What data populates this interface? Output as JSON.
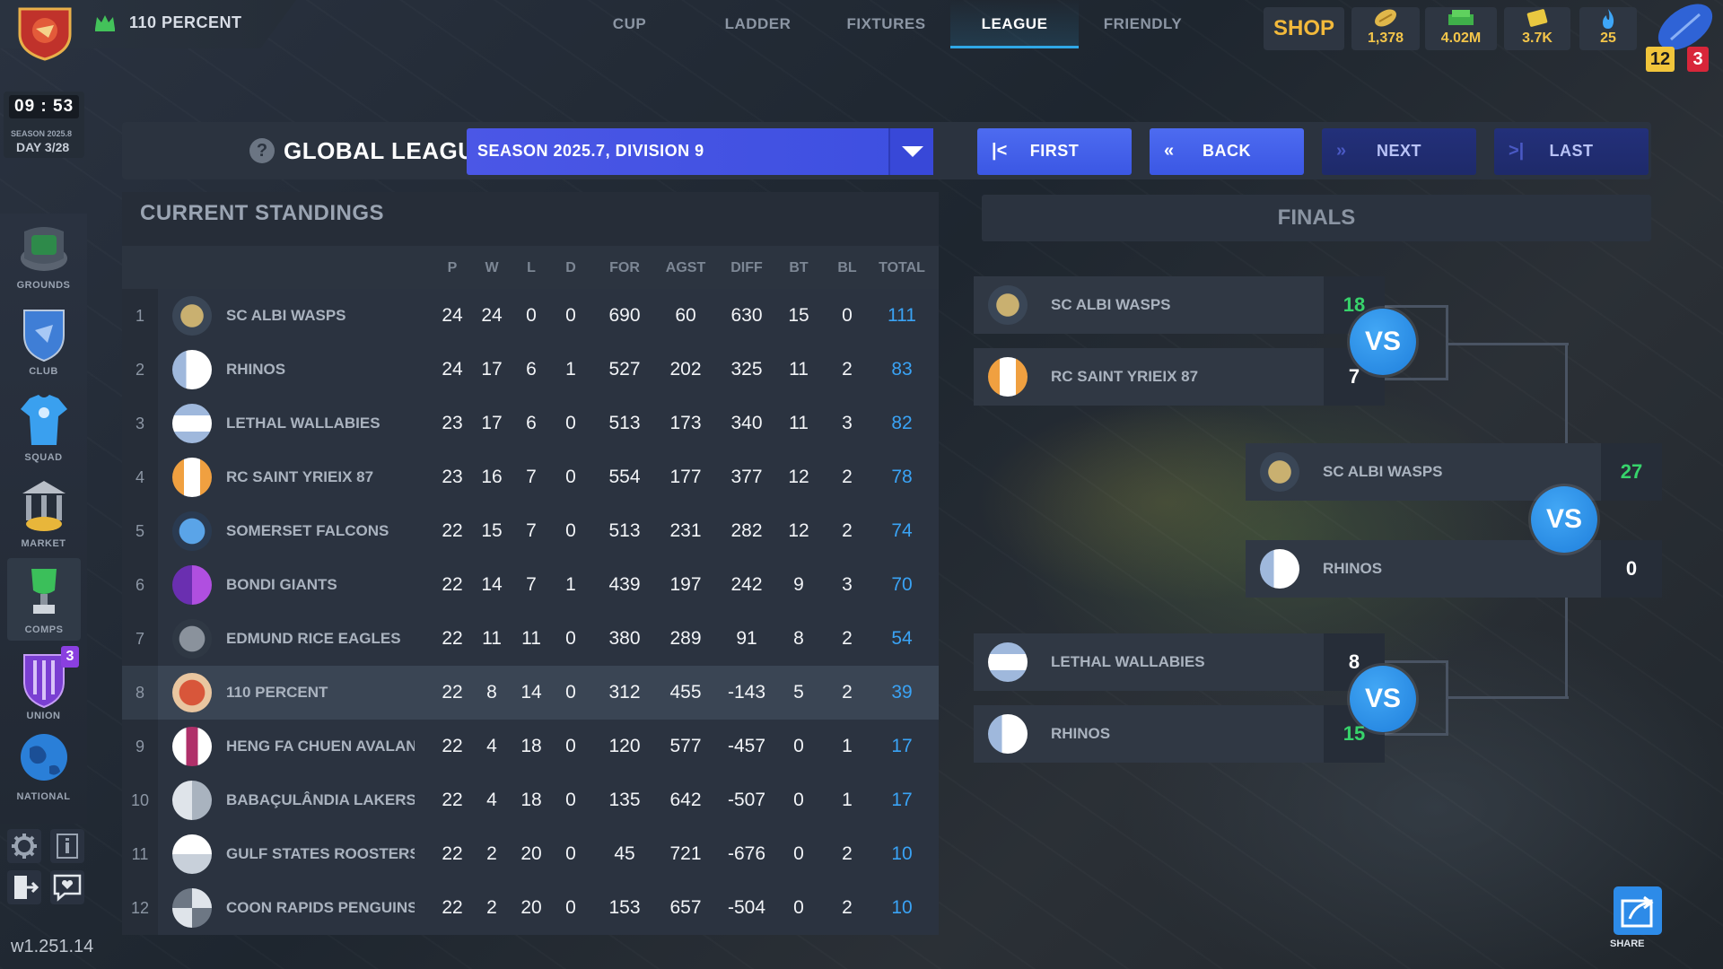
{
  "header": {
    "club_name": "110 PERCENT",
    "tabs": [
      "CUP",
      "LADDER",
      "FIXTURES",
      "LEAGUE",
      "FRIENDLY"
    ],
    "active_tab": "LEAGUE",
    "shop_label": "SHOP",
    "currencies": [
      {
        "icon": "rugby-ball-icon",
        "value": "1,378"
      },
      {
        "icon": "cash-icon",
        "value": "4.02M"
      },
      {
        "icon": "ticket-icon",
        "value": "3.7K"
      },
      {
        "icon": "flame-icon",
        "value": "25"
      }
    ],
    "level_badge": "12",
    "notification_badge": "3"
  },
  "timer": {
    "clock_h": "09",
    "clock_m": "53",
    "season": "SEASON 2025.8",
    "day": "DAY 3/28"
  },
  "sidebar": {
    "items": [
      {
        "label": "GROUNDS",
        "icon": "stadium-icon"
      },
      {
        "label": "CLUB",
        "icon": "club-crest-icon"
      },
      {
        "label": "SQUAD",
        "icon": "jersey-icon"
      },
      {
        "label": "MARKET",
        "icon": "bank-icon"
      },
      {
        "label": "COMPS",
        "icon": "trophy-icon"
      },
      {
        "label": "UNION",
        "icon": "union-shield-icon",
        "badge": "3"
      },
      {
        "label": "NATIONAL",
        "icon": "globe-icon"
      }
    ],
    "version": "w1.251.14"
  },
  "league": {
    "title": "GLOBAL LEAGUE",
    "season_select": "SEASON 2025.7, DIVISION 9",
    "nav": {
      "first": "FIRST",
      "back": "BACK",
      "next": "NEXT",
      "last": "LAST"
    }
  },
  "standings": {
    "title": "CURRENT STANDINGS",
    "columns": [
      "P",
      "W",
      "L",
      "D",
      "FOR",
      "AGST",
      "DIFF",
      "BT",
      "BL",
      "TOTAL"
    ],
    "rows": [
      {
        "rank": "1",
        "team": "SC ALBI WASPS",
        "p": "24",
        "w": "24",
        "l": "0",
        "d": "0",
        "for": "690",
        "agst": "60",
        "diff": "630",
        "bt": "15",
        "bl": "0",
        "total": "111"
      },
      {
        "rank": "2",
        "team": "RHINOS",
        "p": "24",
        "w": "17",
        "l": "6",
        "d": "1",
        "for": "527",
        "agst": "202",
        "diff": "325",
        "bt": "11",
        "bl": "2",
        "total": "83"
      },
      {
        "rank": "3",
        "team": "LETHAL WALLABIES",
        "p": "23",
        "w": "17",
        "l": "6",
        "d": "0",
        "for": "513",
        "agst": "173",
        "diff": "340",
        "bt": "11",
        "bl": "3",
        "total": "82"
      },
      {
        "rank": "4",
        "team": "RC SAINT YRIEIX 87",
        "p": "23",
        "w": "16",
        "l": "7",
        "d": "0",
        "for": "554",
        "agst": "177",
        "diff": "377",
        "bt": "12",
        "bl": "2",
        "total": "78"
      },
      {
        "rank": "5",
        "team": "SOMERSET FALCONS",
        "p": "22",
        "w": "15",
        "l": "7",
        "d": "0",
        "for": "513",
        "agst": "231",
        "diff": "282",
        "bt": "12",
        "bl": "2",
        "total": "74"
      },
      {
        "rank": "6",
        "team": "BONDI GIANTS",
        "p": "22",
        "w": "14",
        "l": "7",
        "d": "1",
        "for": "439",
        "agst": "197",
        "diff": "242",
        "bt": "9",
        "bl": "3",
        "total": "70"
      },
      {
        "rank": "7",
        "team": "EDMUND RICE EAGLES",
        "p": "22",
        "w": "11",
        "l": "11",
        "d": "0",
        "for": "380",
        "agst": "289",
        "diff": "91",
        "bt": "8",
        "bl": "2",
        "total": "54"
      },
      {
        "rank": "8",
        "team": "110 PERCENT",
        "p": "22",
        "w": "8",
        "l": "14",
        "d": "0",
        "for": "312",
        "agst": "455",
        "diff": "-143",
        "bt": "5",
        "bl": "2",
        "total": "39"
      },
      {
        "rank": "9",
        "team": "HENG FA CHUEN AVALAN",
        "p": "22",
        "w": "4",
        "l": "18",
        "d": "0",
        "for": "120",
        "agst": "577",
        "diff": "-457",
        "bt": "0",
        "bl": "1",
        "total": "17"
      },
      {
        "rank": "10",
        "team": "BABAÇULÂNDIA LAKERS",
        "p": "22",
        "w": "4",
        "l": "18",
        "d": "0",
        "for": "135",
        "agst": "642",
        "diff": "-507",
        "bt": "0",
        "bl": "1",
        "total": "17"
      },
      {
        "rank": "11",
        "team": "GULF STATES ROOSTERS",
        "p": "22",
        "w": "2",
        "l": "20",
        "d": "0",
        "for": "45",
        "agst": "721",
        "diff": "-676",
        "bt": "0",
        "bl": "2",
        "total": "10"
      },
      {
        "rank": "12",
        "team": "COON RAPIDS PENGUINS",
        "p": "22",
        "w": "2",
        "l": "20",
        "d": "0",
        "for": "153",
        "agst": "657",
        "diff": "-504",
        "bt": "0",
        "bl": "2",
        "total": "10"
      }
    ]
  },
  "finals": {
    "title": "FINALS",
    "vs_label": "VS",
    "semi1": {
      "team_a": "SC ALBI WASPS",
      "score_a": "18",
      "team_b": "RC SAINT YRIEIX 87",
      "score_b": "7"
    },
    "semi2": {
      "team_a": "LETHAL WALLABIES",
      "score_a": "8",
      "team_b": "RHINOS",
      "score_b": "15"
    },
    "final": {
      "team_a": "SC ALBI WASPS",
      "score_a": "27",
      "team_b": "RHINOS",
      "score_b": "0"
    }
  },
  "share_label": "SHARE",
  "colors": {
    "accent": "#2fa8e6",
    "total": "#3aa3f5",
    "win_score": "#37d36b",
    "shop": "#f2b93b"
  }
}
